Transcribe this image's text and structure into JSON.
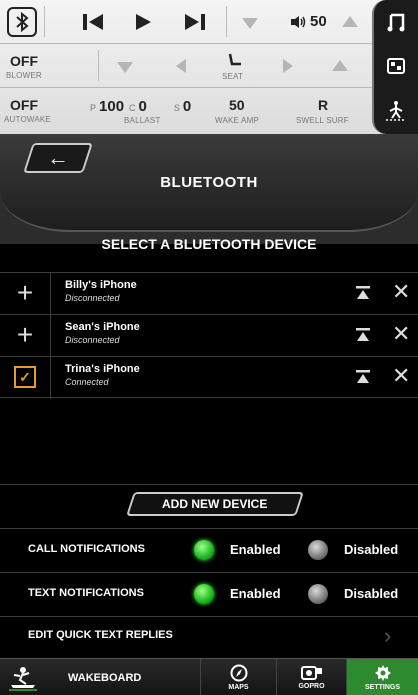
{
  "media_bar": {
    "volume": "50"
  },
  "climate_bar": {
    "blower_value": "OFF",
    "blower_label": "BLOWER",
    "seat_label": "SEAT"
  },
  "boat_bar": {
    "autowake_value": "OFF",
    "autowake_label": "AUTOWAKE",
    "ballast_p_letter": "P",
    "ballast_p_value": "100",
    "ballast_c_letter": "C",
    "ballast_c_value": "0",
    "ballast_label": "BALLAST",
    "ballast_s_letter": "S",
    "ballast_s_value": "0",
    "wake_amp_value": "50",
    "wake_amp_label": "WAKE AMP",
    "swell_surf_value": "R",
    "swell_surf_label": "SWELL SURF"
  },
  "header": {
    "title": "BLUETOOTH"
  },
  "subtitle": "SELECT A BLUETOOTH DEVICE",
  "devices": [
    {
      "name": "Billy's iPhone",
      "status": "Disconnected",
      "connected": false
    },
    {
      "name": "Sean's iPhone",
      "status": "Disconnected",
      "connected": false
    },
    {
      "name": "Trina's iPhone",
      "status": "Connected",
      "connected": true
    }
  ],
  "add_button": "ADD NEW DEVICE",
  "notifications": {
    "call_label": "CALL NOTIFICATIONS",
    "text_label": "TEXT NOTIFICATIONS",
    "enabled": "Enabled",
    "disabled": "Disabled",
    "call_state": "enabled",
    "text_state": "enabled"
  },
  "quick_replies": "EDIT QUICK TEXT REPLIES",
  "nav": {
    "wakeboard": "WAKEBOARD",
    "maps": "MAPS",
    "gopro": "GOPRO",
    "settings": "SETTINGS"
  },
  "colors": {
    "accent_green": "#2e8a2e",
    "checkbox_orange": "#e89a2e"
  }
}
